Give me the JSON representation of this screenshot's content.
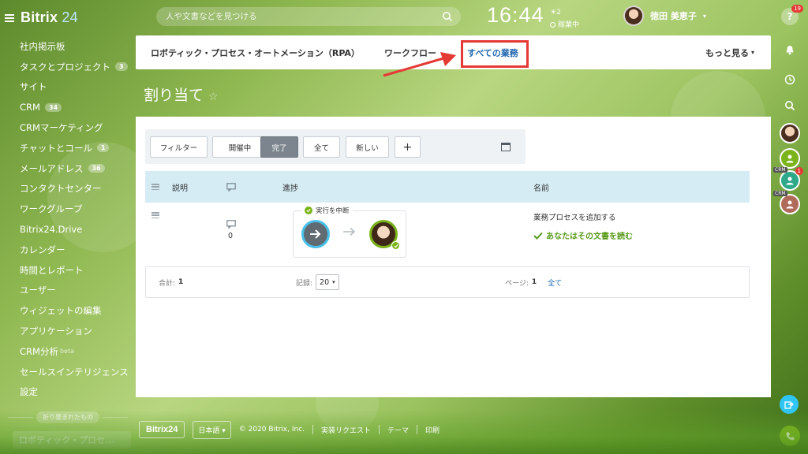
{
  "app": {
    "logo_text": "Bitrix",
    "logo_num": "24"
  },
  "search": {
    "placeholder": "人や文書などを見つける"
  },
  "clock": {
    "time": "16:44",
    "status_top": "2",
    "status": "稼業中"
  },
  "user": {
    "name": "徳田 美恵子"
  },
  "sidebar": {
    "items": [
      {
        "label": "社内掲示板",
        "badge": ""
      },
      {
        "label": "タスクとプロジェクト",
        "badge": "3"
      },
      {
        "label": "サイト",
        "badge": ""
      },
      {
        "label": "CRM",
        "badge": "34"
      },
      {
        "label": "CRMマーケティング",
        "badge": ""
      },
      {
        "label": "チャットとコール",
        "badge": "1"
      },
      {
        "label": "メールアドレス",
        "badge": "36"
      },
      {
        "label": "コンタクトセンター",
        "badge": ""
      },
      {
        "label": "ワークグループ",
        "badge": ""
      },
      {
        "label": "Bitrix24.Drive",
        "badge": ""
      },
      {
        "label": "カレンダー",
        "badge": ""
      },
      {
        "label": "時間とレポート",
        "badge": ""
      },
      {
        "label": "ユーザー",
        "badge": ""
      },
      {
        "label": "ウィジェットの編集",
        "badge": ""
      },
      {
        "label": "アプリケーション",
        "badge": ""
      },
      {
        "label": "CRM分析",
        "badge": "",
        "suffix": "beta"
      },
      {
        "label": "セールスインテリジェンス",
        "badge": ""
      },
      {
        "label": "設定",
        "badge": ""
      }
    ],
    "collapsed_label": "折り畳まれたもの",
    "pinned_item": "ロボティック・プロセ..."
  },
  "topnav": {
    "rpa": "ロボティック・プロセス・オートメーション（RPA）",
    "workflow": "ワークフロー",
    "all_tasks": "すべての業務",
    "more": "もっと見る"
  },
  "page": {
    "title": "割り当て"
  },
  "toolbar": {
    "filter": "フィルター",
    "in_progress": "開催中",
    "done": "完了",
    "all": "全て",
    "new": "新しい",
    "add": "+"
  },
  "grid": {
    "headers": {
      "description": "説明",
      "progress": "進捗",
      "name": "名前"
    },
    "rows": [
      {
        "comments": "0",
        "progress_label": "実行を中断",
        "name": "業務プロセスを追加する",
        "task": "あなたはその文書を読む"
      }
    ]
  },
  "pager": {
    "total_label": "合計:",
    "total_value": "1",
    "records_label": "記録:",
    "records_value": "20",
    "page_label": "ページ:",
    "page_value": "1",
    "all_link": "全て"
  },
  "footer": {
    "logo": "Bitrix24",
    "language": "日本語",
    "copyright": "© 2020 Bitrix, Inc.",
    "support": "実装リクエスト",
    "theme": "テーマ",
    "print": "印刷"
  },
  "rail": {
    "help_badge": "19",
    "crm_badge": "1",
    "crm_label": "CRM"
  },
  "colors": {
    "accent": "#2067b0",
    "done_green": "#7bb31a",
    "header_blue": "#d5ecf5",
    "highlight_red": "#e53935"
  }
}
